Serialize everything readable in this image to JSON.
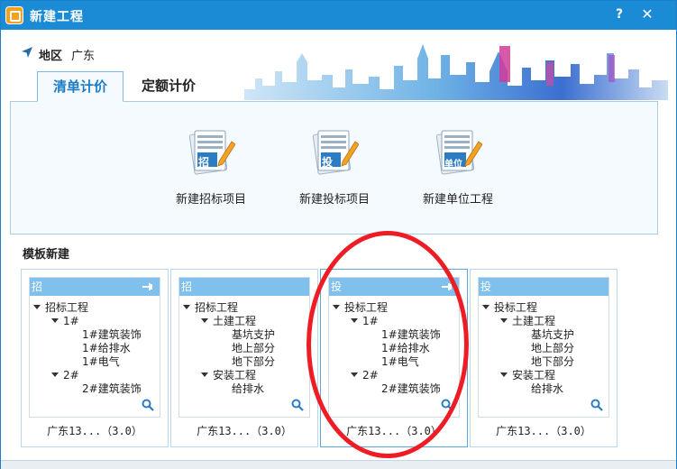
{
  "window": {
    "title": "新建工程",
    "help_label": "?",
    "close_label": "✕",
    "accent_color": "#1b8bd6"
  },
  "region": {
    "label": "地区",
    "value": "广东",
    "icon": "navigation-arrow-icon"
  },
  "tabs": [
    {
      "label": "清单计价",
      "active": true
    },
    {
      "label": "定额计价",
      "active": false
    }
  ],
  "actions": [
    {
      "label": "新建招标项目",
      "badge": "招",
      "icon": "document-pencil-icon"
    },
    {
      "label": "新建投标项目",
      "badge": "投",
      "icon": "document-pencil-icon"
    },
    {
      "label": "新建单位工程",
      "badge": "单位",
      "icon": "document-pencil-icon"
    }
  ],
  "templates": {
    "section_label": "模板新建",
    "cards": [
      {
        "badge": "招",
        "footer": "广东13...（3.0）",
        "tree": [
          "招标工程",
          "1#",
          "1#建筑装饰",
          "1#给排水",
          "1#电气",
          "2#",
          "2#建筑装饰"
        ]
      },
      {
        "badge": "招",
        "footer": "广东13...（3.0）",
        "tree": [
          "招标工程",
          "土建工程",
          "基坑支护",
          "地上部分",
          "地下部分",
          "安装工程",
          "给排水"
        ]
      },
      {
        "badge": "投",
        "footer": "广东13...（3.0）",
        "tree": [
          "投标工程",
          "1#",
          "1#建筑装饰",
          "1#给排水",
          "1#电气",
          "2#",
          "2#建筑装饰"
        ]
      },
      {
        "badge": "投",
        "footer": "广东13...（3.0）",
        "tree": [
          "投标工程",
          "土建工程",
          "基坑支护",
          "地上部分",
          "地下部分",
          "安装工程",
          "给排水"
        ]
      }
    ]
  },
  "annotation_color": "#ee1c24"
}
